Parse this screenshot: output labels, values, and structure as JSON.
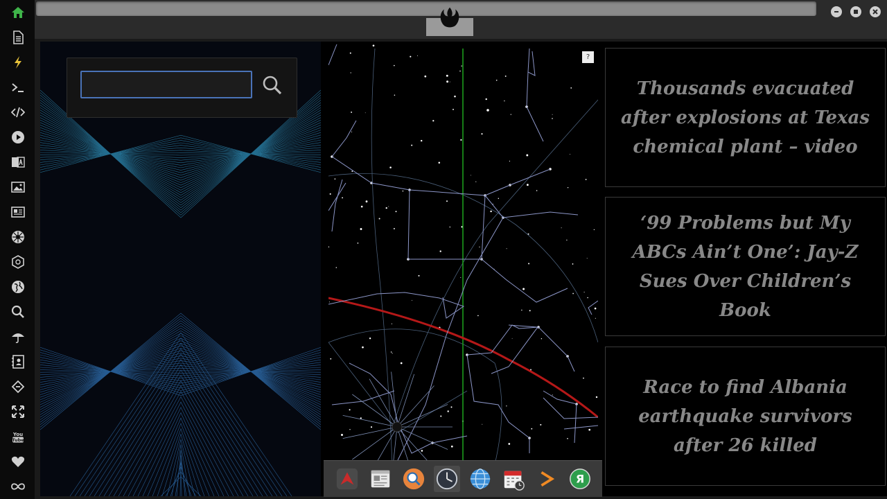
{
  "sidebar": {
    "items": [
      {
        "icon": "home-icon",
        "color": "#3fb44a"
      },
      {
        "icon": "document-icon",
        "color": "#d0d0d0"
      },
      {
        "icon": "lightning-icon",
        "color": "#e8c23a"
      },
      {
        "icon": "terminal-icon",
        "color": "#d0d0d0"
      },
      {
        "icon": "code-icon",
        "color": "#d0d0d0"
      },
      {
        "icon": "play-icon",
        "color": "#d0d0d0"
      },
      {
        "icon": "translate-icon",
        "color": "#d0d0d0"
      },
      {
        "icon": "image-icon",
        "color": "#d0d0d0"
      },
      {
        "icon": "newspaper-icon",
        "color": "#d0d0d0"
      },
      {
        "icon": "rebel-alliance-icon",
        "color": "#d0d0d0"
      },
      {
        "icon": "galactic-empire-icon",
        "color": "#d0d0d0"
      },
      {
        "icon": "globe-icon",
        "color": "#d0d0d0"
      },
      {
        "icon": "search-icon",
        "color": "#d0d0d0"
      },
      {
        "icon": "umbrella-icon",
        "color": "#d0d0d0"
      },
      {
        "icon": "contacts-icon",
        "color": "#d0d0d0"
      },
      {
        "icon": "tag-link-icon",
        "color": "#d0d0d0"
      },
      {
        "icon": "expand-icon",
        "color": "#d0d0d0"
      },
      {
        "icon": "youtube-icon",
        "color": "#d0d0d0"
      },
      {
        "icon": "heart-icon",
        "color": "#d0d0d0"
      },
      {
        "icon": "infinity-icon",
        "color": "#d0d0d0"
      }
    ]
  },
  "titlebar": {
    "logo_icon": "rebel-alliance-icon",
    "window_buttons": [
      "minimize-icon",
      "maximize-icon",
      "close-icon"
    ]
  },
  "search": {
    "value": "",
    "placeholder": "",
    "button_icon": "search-icon",
    "accent": "#4a73b8"
  },
  "skymap": {
    "help_label": "?",
    "ecliptic_color": "#b51818",
    "meridian_color": "#1c9c1c",
    "constellation_color": "#8c96c8"
  },
  "dock": {
    "apps": [
      {
        "name": "dock-app-arrow",
        "active": false
      },
      {
        "name": "dock-app-news-reader",
        "active": false
      },
      {
        "name": "dock-app-search",
        "active": false
      },
      {
        "name": "dock-app-clock",
        "active": true
      },
      {
        "name": "dock-app-globe",
        "active": false
      },
      {
        "name": "dock-app-calendar",
        "active": false
      },
      {
        "name": "dock-app-sublime",
        "active": false
      },
      {
        "name": "dock-app-yandex",
        "active": false
      }
    ]
  },
  "news": [
    {
      "headline": "Thousands evacuated after explosions at Texas chemical plant – video"
    },
    {
      "headline": "‘99 Problems but My ABCs Ain’t One’: Jay-Z Sues Over Children’s Book"
    },
    {
      "headline": "Race to find Albania earthquake survivors after 26 killed"
    }
  ]
}
